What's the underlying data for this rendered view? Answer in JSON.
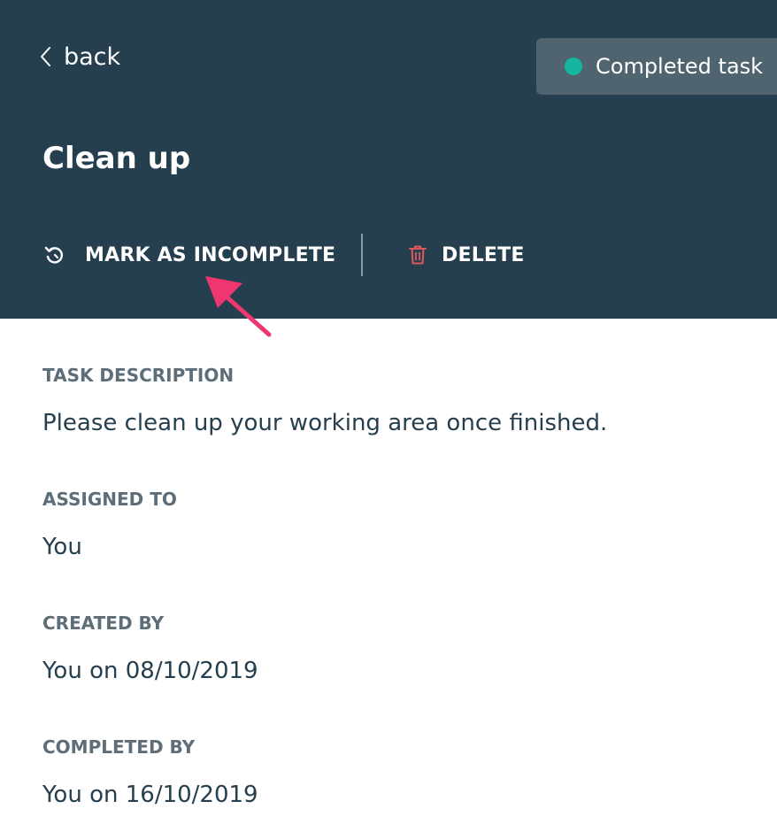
{
  "header": {
    "back_label": "back",
    "title": "Clean up",
    "status": {
      "label": "Completed task",
      "dot_color": "#13b5a0"
    },
    "actions": {
      "mark_incomplete_label": "MARK AS INCOMPLETE",
      "delete_label": "DELETE"
    }
  },
  "details": {
    "description": {
      "label": "TASK DESCRIPTION",
      "value": "Please clean up your working area once finished."
    },
    "assigned_to": {
      "label": "ASSIGNED TO",
      "value": "You"
    },
    "created_by": {
      "label": "CREATED BY",
      "value": "You on 08/10/2019"
    },
    "completed_by": {
      "label": "COMPLETED BY",
      "value": "You on 16/10/2019"
    }
  },
  "colors": {
    "header_bg": "#263f4f",
    "badge_bg": "#50646f",
    "accent_teal": "#13b5a0",
    "delete_red": "#e0575b",
    "annotation_pink": "#f0366e"
  },
  "icons": {
    "back": "chevron-left-icon",
    "status": "status-dot-icon",
    "mark_incomplete": "undo-icon",
    "delete": "trash-icon"
  }
}
